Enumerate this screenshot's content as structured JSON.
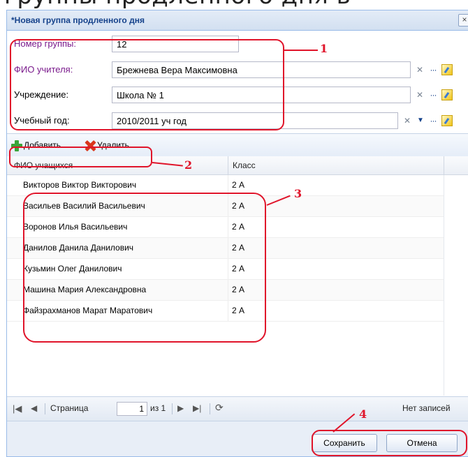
{
  "window": {
    "title": "*Новая группа продленного дня",
    "close_label": "×"
  },
  "form": {
    "group_number": {
      "label": "Номер группы:",
      "value": "12"
    },
    "teacher": {
      "label": "ФИО учителя:",
      "value": "Брежнева Вера Максимовна"
    },
    "institution": {
      "label": "Учреждение:",
      "value": "Школа № 1"
    },
    "school_year": {
      "label": "Учебный год:",
      "value": "2010/2011 уч год"
    }
  },
  "toolbar": {
    "add_label": "Добавить",
    "delete_label": "Удалить"
  },
  "grid": {
    "columns": [
      "ФИО учащихся",
      "Класс"
    ],
    "rows": [
      {
        "name": "Викторов Виктор Викторович",
        "class": "2 А"
      },
      {
        "name": "Васильев Василий Васильевич",
        "class": "2 А"
      },
      {
        "name": "Воронов Илья Васильевич",
        "class": "2 А"
      },
      {
        "name": "Данилов Данила Данилович",
        "class": "2 А"
      },
      {
        "name": "Кузьмин Олег Данилович",
        "class": "2 А"
      },
      {
        "name": "Машина Мария Александровна",
        "class": "2 А"
      },
      {
        "name": "Файзрахманов Марат Маратович",
        "class": "2 А"
      }
    ]
  },
  "paging": {
    "page_label": "Страница",
    "page_value": "1",
    "of_label": "из 1",
    "status": "Нет записей"
  },
  "footer": {
    "save_label": "Сохранить",
    "cancel_label": "Отмена"
  },
  "annotations": [
    "1",
    "2",
    "3",
    "4"
  ],
  "colors": {
    "annotation": "#e0142a",
    "label_purple": "#7a1a8c",
    "window_border": "#99bbe8"
  }
}
